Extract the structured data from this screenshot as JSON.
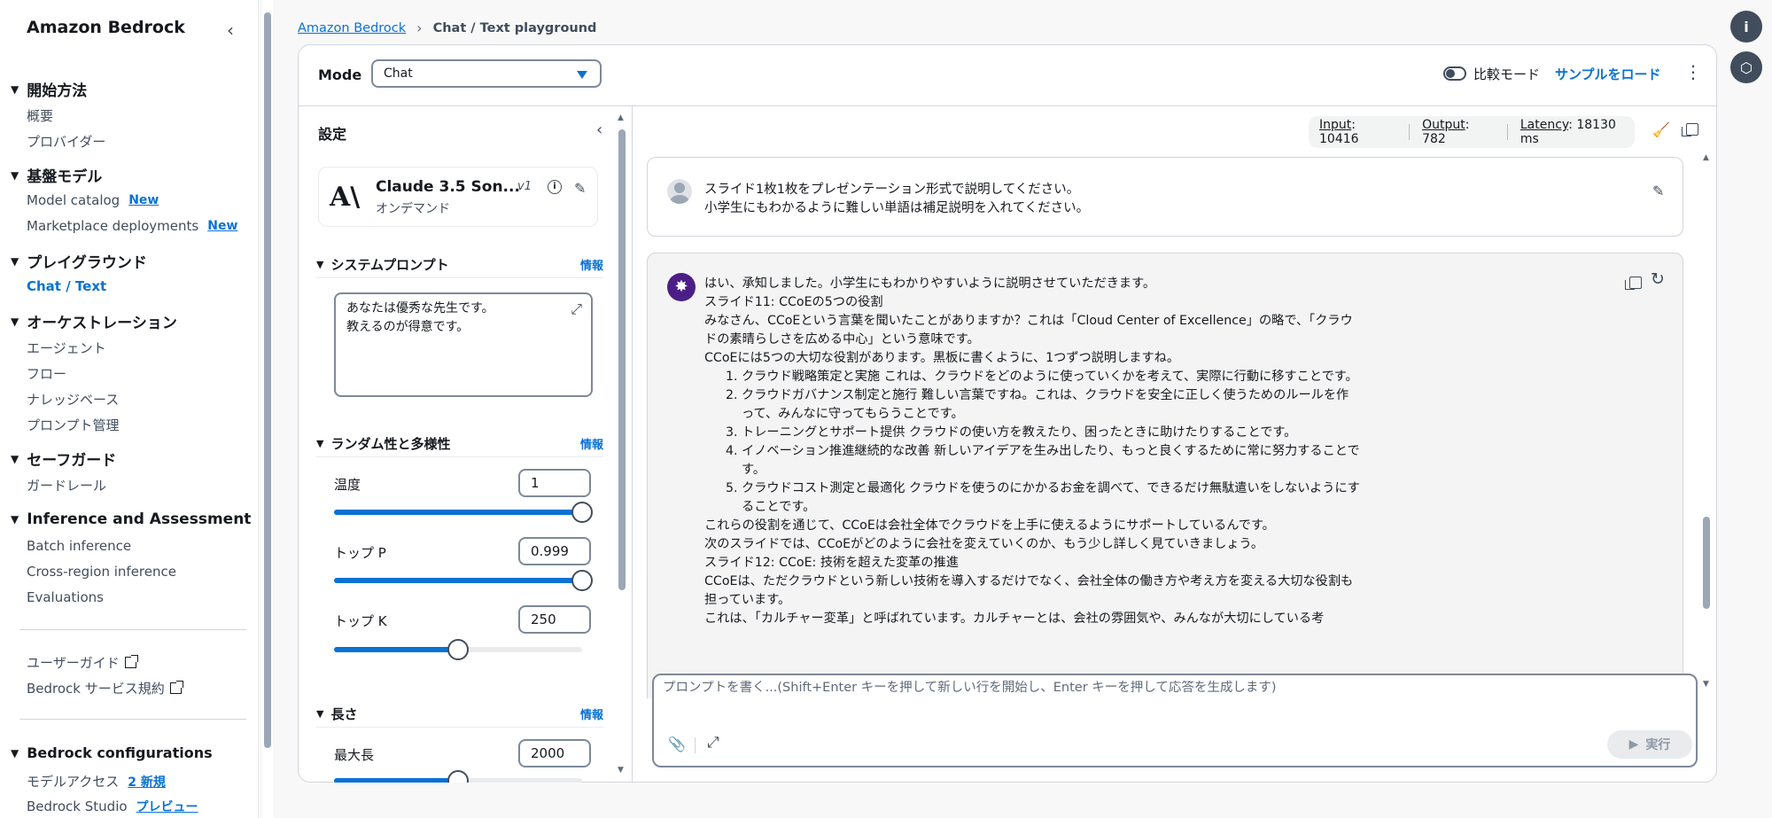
{
  "sidebar": {
    "title": "Amazon Bedrock",
    "sections": [
      {
        "label": "開始方法",
        "items": [
          {
            "label": "概要"
          },
          {
            "label": "プロバイダー"
          }
        ]
      },
      {
        "label": "基盤モデル",
        "items": [
          {
            "label": "Model catalog",
            "badge": "New"
          },
          {
            "label": "Marketplace deployments",
            "badge": "New"
          }
        ]
      },
      {
        "label": "プレイグラウンド",
        "items": [
          {
            "label": "Chat / Text"
          }
        ]
      },
      {
        "label": "オーケストレーション",
        "items": [
          {
            "label": "エージェント"
          },
          {
            "label": "フロー"
          },
          {
            "label": "ナレッジベース"
          },
          {
            "label": "プロンプト管理"
          }
        ]
      },
      {
        "label": "セーフガード",
        "items": [
          {
            "label": "ガードレール"
          }
        ]
      },
      {
        "label": "Inference and Assessment",
        "items": [
          {
            "label": "Batch inference"
          },
          {
            "label": "Cross-region inference"
          },
          {
            "label": "Evaluations"
          }
        ]
      }
    ],
    "links": [
      {
        "label": "ユーザーガイド"
      },
      {
        "label": "Bedrock サービス規約"
      }
    ],
    "config_section": {
      "label": "Bedrock configurations",
      "items": [
        {
          "label": "モデルアクセス",
          "badge": "2 新規"
        },
        {
          "label": "Bedrock Studio",
          "badge": "プレビュー"
        }
      ]
    }
  },
  "breadcrumb": {
    "root": "Amazon Bedrock",
    "current": "Chat / Text playground"
  },
  "header": {
    "mode_label": "Mode",
    "mode_value": "Chat",
    "compare_label": "比較モード",
    "load_sample": "サンプルをロード"
  },
  "settings": {
    "title": "設定",
    "model": {
      "name": "Claude 3.5 Son...",
      "version": "v1",
      "subtitle": "オンデマンド"
    },
    "system_prompt": {
      "label": "システムプロンプト",
      "info": "情報",
      "line1": "あなたは優秀な先生です。",
      "line2": "教えるのが得意です。"
    },
    "randomness": {
      "label": "ランダム性と多様性",
      "info": "情報",
      "temperature": {
        "label": "温度",
        "value": "1",
        "fraction": 1.0
      },
      "top_p": {
        "label": "トップ P",
        "value": "0.999",
        "fraction": 1.0
      },
      "top_k": {
        "label": "トップ K",
        "value": "250",
        "fraction": 0.5
      }
    },
    "length": {
      "label": "長さ",
      "info": "情報",
      "max_length": {
        "label": "最大長",
        "value": "2000",
        "fraction": 0.5
      }
    }
  },
  "metrics": {
    "input_label": "Input",
    "input_value": ": 10416",
    "output_label": "Output",
    "output_value": ": 782",
    "latency_label": "Latency",
    "latency_value": ": 18130 ms"
  },
  "chat": {
    "user_message": {
      "line1": "スライド1枚1枚をプレゼンテーション形式で説明してください。",
      "line2": "小学生にもわかるように難しい単語は補足説明を入れてください。"
    },
    "ai_message": {
      "p1": "はい、承知しました。小学生にもわかりやすいように説明させていただきます。",
      "p2": "スライド11: CCoEの5つの役割",
      "p3": "みなさん、CCoEという言葉を聞いたことがありますか？これは「Cloud Center of Excellence」の略で、「クラウドの素晴らしさを広める中心」という意味です。",
      "p4": "CCoEには5つの大切な役割があります。黒板に書くように、1つずつ説明しますね。",
      "list": [
        "クラウド戦略策定と実施 これは、クラウドをどのように使っていくかを考えて、実際に行動に移すことです。",
        "クラウドガバナンス制定と施行 難しい言葉ですね。これは、クラウドを安全に正しく使うためのルールを作って、みんなに守ってもらうことです。",
        "トレーニングとサポート提供 クラウドの使い方を教えたり、困ったときに助けたりすることです。",
        "イノベーション推進継続的な改善 新しいアイデアを生み出したり、もっと良くするために常に努力することです。",
        "クラウドコスト測定と最適化 クラウドを使うのにかかるお金を調べて、できるだけ無駄遣いをしないようにすることです。"
      ],
      "p5": "これらの役割を通じて、CCoEは会社全体でクラウドを上手に使えるようにサポートしているんです。",
      "p6": "次のスライドでは、CCoEがどのように会社を変えていくのか、もう少し詳しく見ていきましょう。",
      "p7": "スライド12: CCoE: 技術を超えた変革の推進",
      "p8": "CCoEは、ただクラウドという新しい技術を導入するだけでなく、会社全体の働き方や考え方を変える大切な役割も担っています。",
      "p9": "これは、「カルチャー変革」と呼ばれています。カルチャーとは、会社の雰囲気や、みんなが大切にしている考"
    }
  },
  "prompt": {
    "placeholder": "プロンプトを書く...(Shift+Enter キーを押して新しい行を開始し、Enter キーを押して応答を生成します)",
    "run_label": "実行"
  },
  "colors": {
    "accent": "#0972d3",
    "text": "#16191f",
    "border": "#d1d5db",
    "ai_avatar": "#4b1e87"
  }
}
